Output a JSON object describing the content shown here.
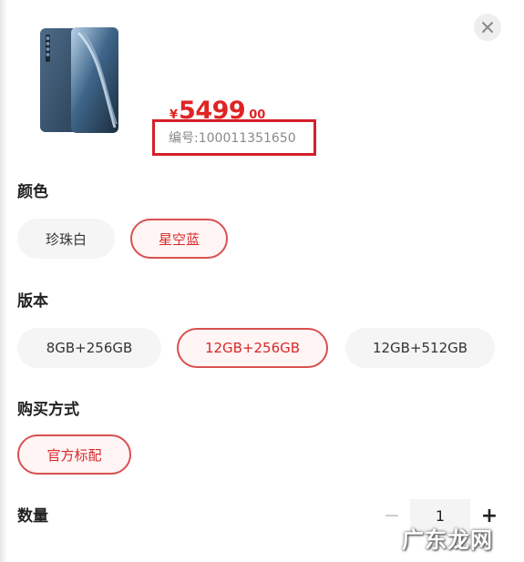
{
  "product": {
    "image_alt": "Mi 10 Pro phone",
    "price_symbol": "¥",
    "price_integer": "5499",
    "price_decimal": "00",
    "sku_label": "编号:100011351650"
  },
  "close_icon": "close-icon",
  "color_section": {
    "title": "颜色",
    "options": [
      {
        "label": "珍珠白",
        "selected": false
      },
      {
        "label": "星空蓝",
        "selected": true
      }
    ]
  },
  "version_section": {
    "title": "版本",
    "options": [
      {
        "label": "8GB+256GB",
        "selected": false
      },
      {
        "label": "12GB+256GB",
        "selected": true
      },
      {
        "label": "12GB+512GB",
        "selected": false
      }
    ]
  },
  "purchase_section": {
    "title": "购买方式",
    "options": [
      {
        "label": "官方标配",
        "selected": true
      }
    ]
  },
  "quantity": {
    "title": "数量",
    "value": "1",
    "minus": "−",
    "plus": "+"
  },
  "watermark": {
    "text": "广东龙网"
  },
  "colors": {
    "accent": "#e02424",
    "highlight_border": "#d51f2a",
    "chip_bg": "#f5f5f5"
  }
}
